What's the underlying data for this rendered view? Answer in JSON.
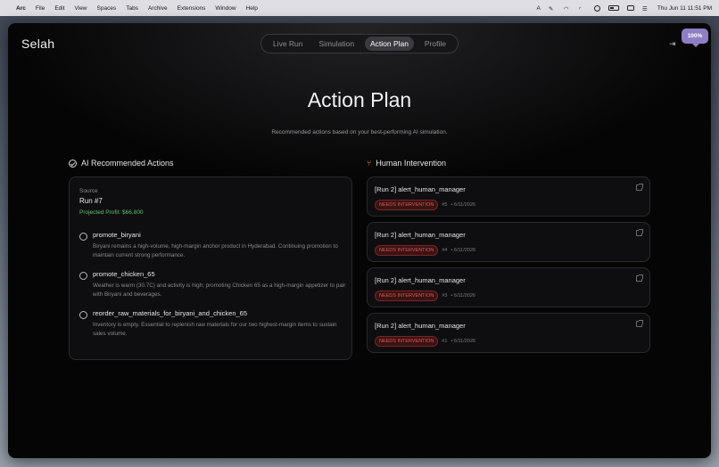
{
  "menubar": {
    "app": "Arc",
    "items": [
      "File",
      "Edit",
      "View",
      "Spaces",
      "Tabs",
      "Archive",
      "Extensions",
      "Window",
      "Help"
    ],
    "input_indicator": "A",
    "datetime": "Thu Jun 11  11:51 PM"
  },
  "header": {
    "brand": "Selah",
    "tabs": [
      {
        "label": "Live Run"
      },
      {
        "label": "Simulation"
      },
      {
        "label": "Action Plan"
      },
      {
        "label": "Profile"
      }
    ],
    "active_tab": "Action Plan",
    "zoom_badge": "100%"
  },
  "main": {
    "title": "Action Plan",
    "subtitle": "Recommended actions based on your best-performing AI simulation.",
    "ai_section": {
      "heading": "AI Recommended Actions",
      "source_label": "Source",
      "run": "Run #7",
      "profit": "Projected Profit: $66,800",
      "actions": [
        {
          "title": "promote_biryani",
          "desc": "Biryani remains a high-volume, high-margin anchor product in Hyderabad. Continuing promotion to maintain current strong performance."
        },
        {
          "title": "promote_chicken_65",
          "desc": "Weather is warm (30.7C) and activity is high; promoting Chicken 65 as a high-margin appetizer to pair with Biryani and beverages."
        },
        {
          "title": "reorder_raw_materials_for_biryani_and_chicken_65",
          "desc": "Inventory is empty. Essential to replenish raw materials for our two highest-margin items to sustain sales volume."
        }
      ]
    },
    "human_section": {
      "heading": "Human Intervention",
      "items": [
        {
          "title": "[Run 2] alert_human_manager",
          "badge": "NEEDS INTERVENTION",
          "id": "#5",
          "date": "• 6/11/2026"
        },
        {
          "title": "[Run 2] alert_human_manager",
          "badge": "NEEDS INTERVENTION",
          "id": "#4",
          "date": "• 6/11/2026"
        },
        {
          "title": "[Run 2] alert_human_manager",
          "badge": "NEEDS INTERVENTION",
          "id": "#3",
          "date": "• 6/11/2026"
        },
        {
          "title": "[Run 2] alert_human_manager",
          "badge": "NEEDS INTERVENTION",
          "id": "#1",
          "date": "• 6/11/2026"
        }
      ]
    }
  },
  "colors": {
    "accent_purple": "#8f7ec4",
    "profit_green": "#5ec26a",
    "alert_red": "#e0574f"
  }
}
